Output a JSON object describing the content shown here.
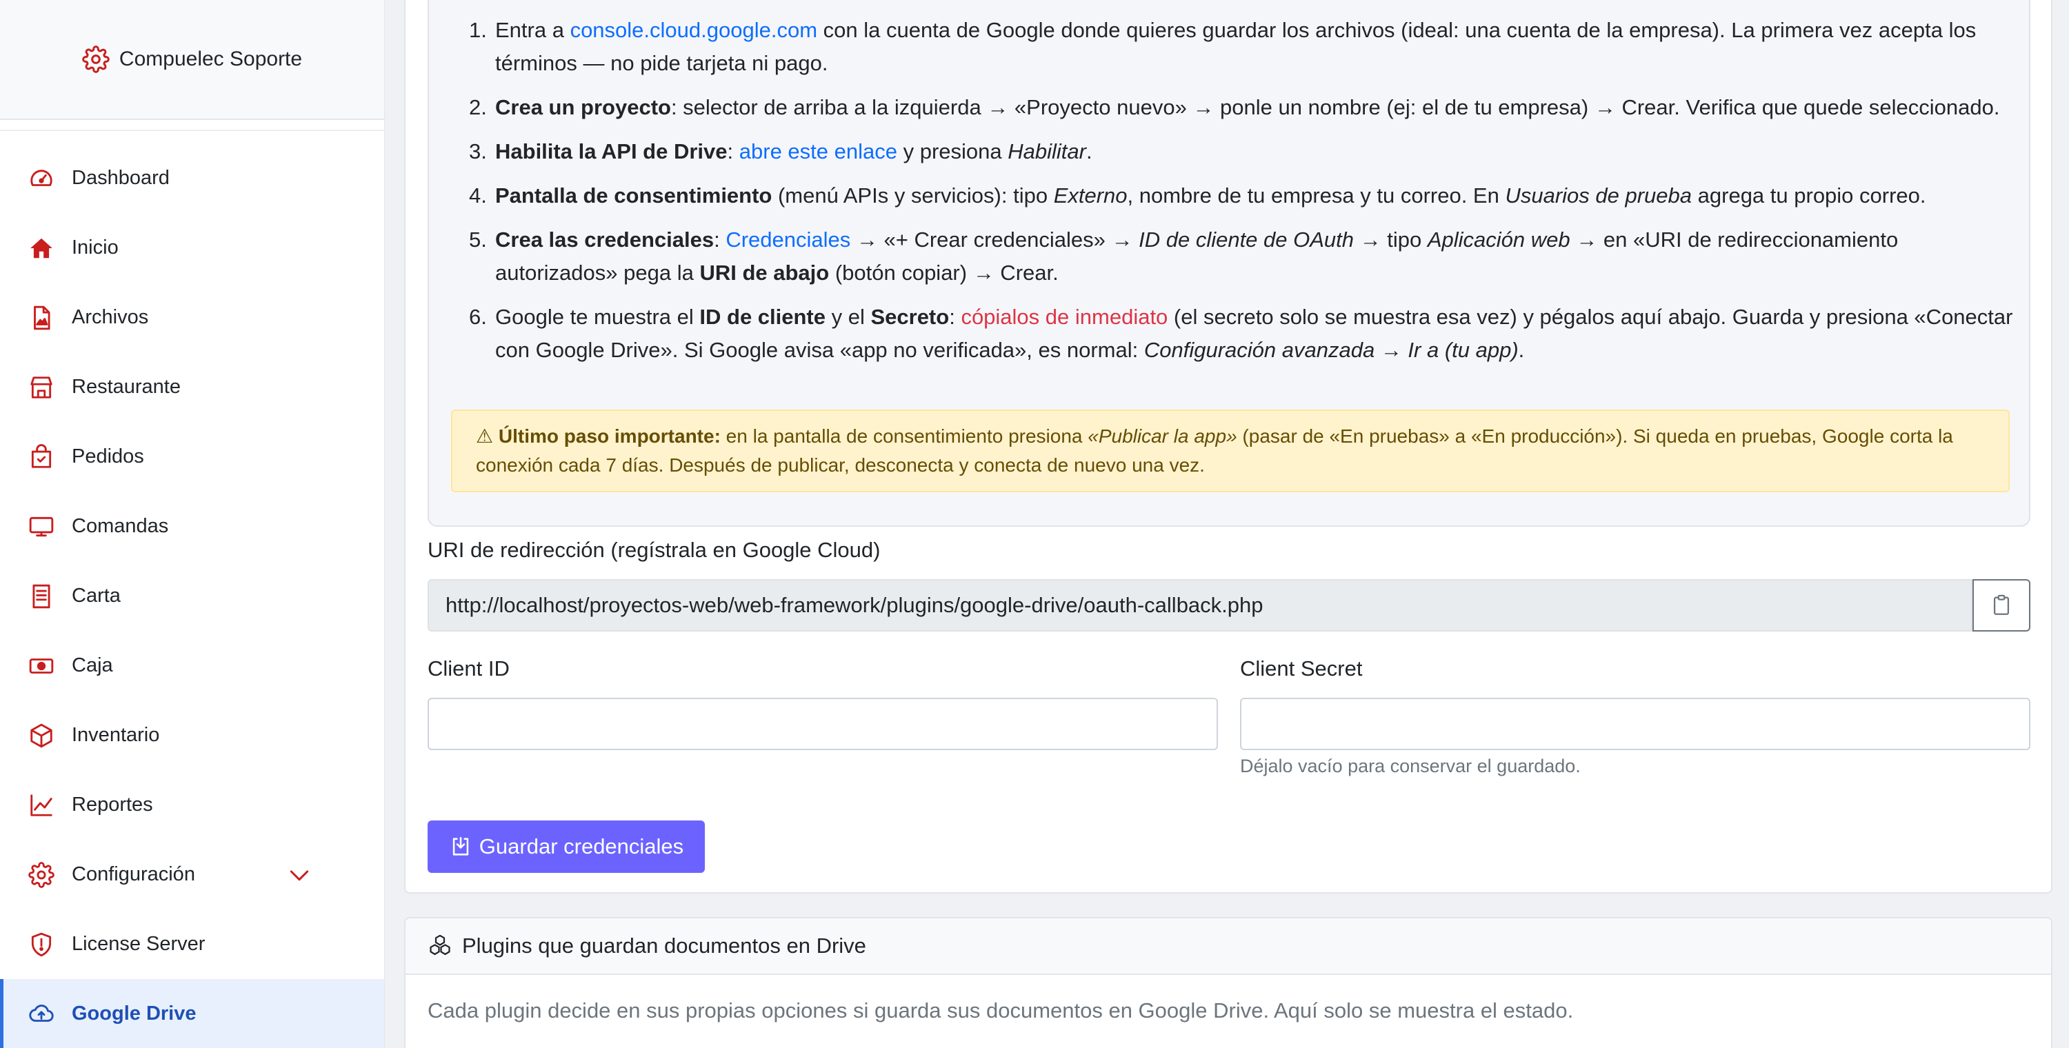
{
  "brand": {
    "name": "Compuelec Soporte",
    "icon": "gear-icon"
  },
  "colors": {
    "accent": "#c81e1e",
    "active": "#1e50b4",
    "primary_button": "#6c63ff",
    "link": "#0d6efd"
  },
  "sidebar": {
    "items": [
      {
        "label": "Dashboard",
        "icon": "speedometer-icon"
      },
      {
        "label": "Inicio",
        "icon": "house-icon"
      },
      {
        "label": "Archivos",
        "icon": "file-image-icon"
      },
      {
        "label": "Restaurante",
        "icon": "shop-icon"
      },
      {
        "label": "Pedidos",
        "icon": "bag-check-icon"
      },
      {
        "label": "Comandas",
        "icon": "display-icon"
      },
      {
        "label": "Carta",
        "icon": "menu-card-icon"
      },
      {
        "label": "Caja",
        "icon": "cash-icon"
      },
      {
        "label": "Inventario",
        "icon": "box-icon"
      },
      {
        "label": "Reportes",
        "icon": "graph-icon"
      },
      {
        "label": "Configuración",
        "icon": "gear-icon"
      },
      {
        "label": "License Server",
        "icon": "shield-icon"
      },
      {
        "label": "Google Drive",
        "icon": "cloud-upload-icon",
        "active": true
      }
    ]
  },
  "steps": [
    {
      "num": "1.",
      "pre": "Entra a ",
      "link": "console.cloud.google.com",
      "post": " con la cuenta de Google donde quieres guardar los archivos (ideal: una cuenta de la empresa). La primera vez acepta los términos — no pide tarjeta ni pago."
    },
    {
      "num": "2.",
      "bold": "Crea un proyecto",
      "text": ": selector de arriba a la izquierda → «Proyecto nuevo» → ponle un nombre (ej: el de tu empresa) → Crear. Verifica que quede seleccionado."
    },
    {
      "num": "3.",
      "bold": "Habilita la API de Drive",
      "sep": ": ",
      "link": "abre este enlace",
      "mid": " y presiona ",
      "italic": "Habilitar",
      "end": "."
    },
    {
      "num": "4.",
      "bold": "Pantalla de consentimiento",
      "t1": " (menú APIs y servicios): tipo ",
      "i1": "Externo",
      "t2": ", nombre de tu empresa y tu correo. En ",
      "i2": "Usuarios de prueba",
      "t3": " agrega tu propio correo."
    },
    {
      "num": "5.",
      "bold": "Crea las credenciales",
      "sep": ": ",
      "link": "Credenciales",
      "t1": " → «+ Crear credenciales» → ",
      "i1": "ID de cliente de OAuth",
      "t2": " → tipo ",
      "i2": "Aplicación web",
      "t3": " → en «URI de redireccionamiento autorizados» pega la ",
      "b2": "URI de abajo",
      "t4": " (botón copiar) → Crear."
    },
    {
      "num": "6.",
      "t1": "Google te muestra el ",
      "b1": "ID de cliente",
      "t2": " y el ",
      "b2": "Secreto",
      "t3": ": ",
      "red": "cópialos de inmediato",
      "t4": " (el secreto solo se muestra esa vez) y pégalos aquí abajo. Guarda y presiona «Conectar con Google Drive». Si Google avisa «app no verificada», es normal: ",
      "i1": "Configuración avanzada → Ir a (tu app)",
      "end": "."
    }
  ],
  "alert": {
    "icon": "warning-icon",
    "icon_glyph": "⚠",
    "title": "Último paso importante:",
    "t1": " en la pantalla de consentimiento presiona ",
    "italic": "«Publicar la app»",
    "t2": " (pasar de «En pruebas» a «En producción»). Si queda en pruebas, Google corta la conexión cada 7 días. Después de publicar, desconecta y conecta de nuevo una vez."
  },
  "form": {
    "uri_label": "URI de redirección (regístrala en Google Cloud)",
    "uri_value": "http://localhost/proyectos-web/web-framework/plugins/google-drive/oauth-callback.php",
    "client_id_label": "Client ID",
    "client_id_value": "",
    "client_secret_label": "Client Secret",
    "client_secret_value": "",
    "client_secret_help": "Déjalo vacío para conservar el guardado.",
    "save_label": "Guardar credenciales"
  },
  "plugins_card": {
    "title": "Plugins que guardan documentos en Drive",
    "body": "Cada plugin decide en sus propias opciones si guarda sus documentos en Google Drive. Aquí solo se muestra el estado."
  }
}
